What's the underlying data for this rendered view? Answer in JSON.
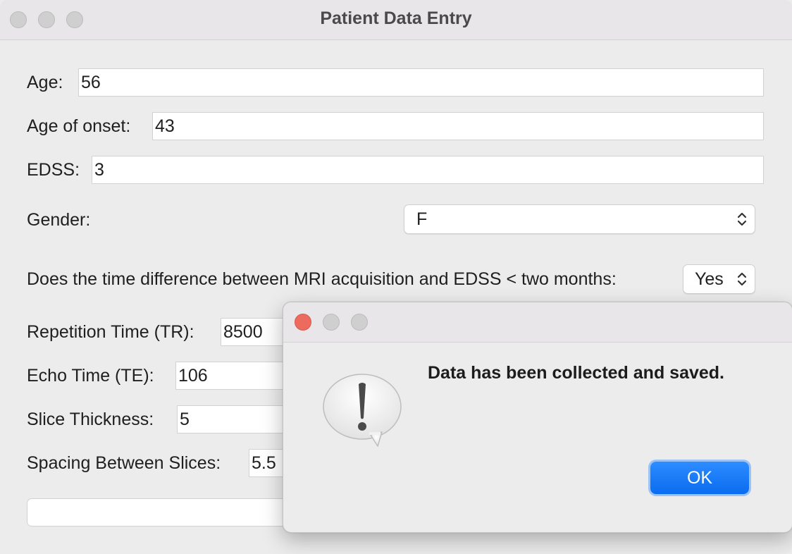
{
  "window": {
    "title": "Patient Data Entry"
  },
  "form": {
    "age_label": "Age:",
    "age_value": "56",
    "onset_label": "Age of onset:",
    "onset_value": "43",
    "edss_label": "EDSS:",
    "edss_value": "3",
    "gender_label": "Gender:",
    "gender_value": "F",
    "time_diff_label": "Does the time difference between MRI acquisition and EDSS < two months:",
    "time_diff_value": "Yes",
    "tr_label": "Repetition Time (TR):",
    "tr_value": "8500",
    "te_label": "Echo Time (TE):",
    "te_value": "106",
    "slice_label": "Slice Thickness:",
    "slice_value": "5",
    "spacing_label": "Spacing Between Slices:",
    "spacing_value": "5.5"
  },
  "dialog": {
    "message": "Data has been collected and saved.",
    "ok_label": "OK",
    "icon": "alert-exclamation-icon"
  },
  "colors": {
    "window_bg": "#ececec",
    "close_red": "#ec6a5e",
    "inactive_gray": "#d0cfd0",
    "ok_blue": "#0a6cf0"
  }
}
